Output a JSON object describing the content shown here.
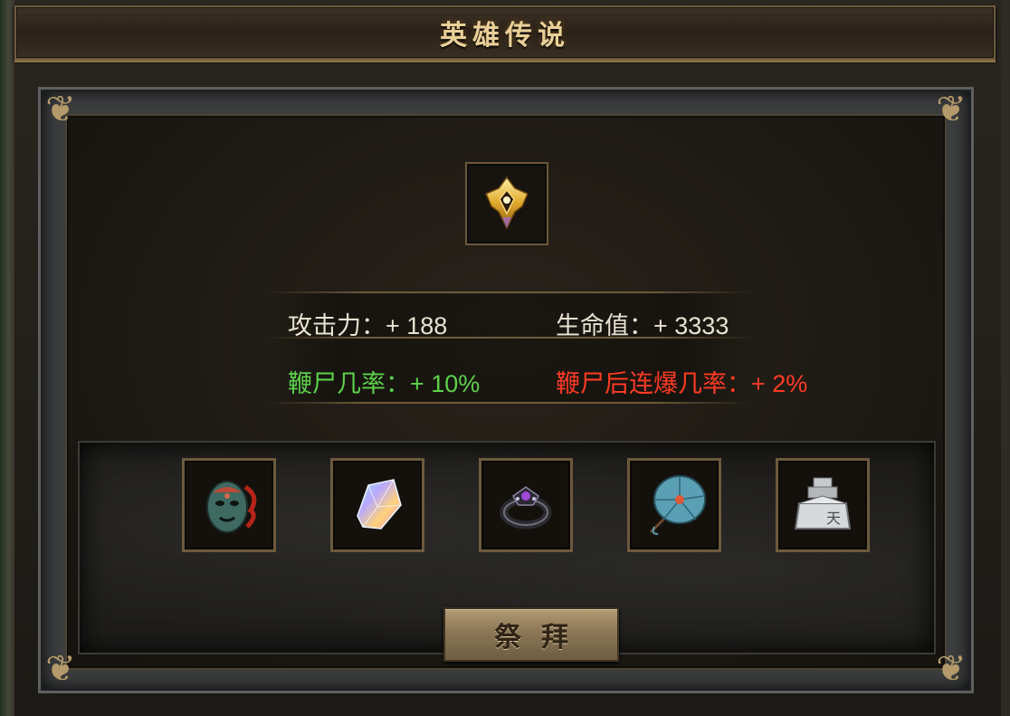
{
  "window": {
    "title": "英雄传说"
  },
  "emblem": {
    "icon": "gold-crest-emblem-icon"
  },
  "stats": {
    "attack": "攻击力：+ 188",
    "hp": "生命值：+ 3333",
    "whip_rate": "鞭尸几率：+ 10%",
    "whip_combo_rate": "鞭尸后连爆几率：+ 2%"
  },
  "colors": {
    "title_gold": "#e9cf98",
    "stat_white": "#e8e2d2",
    "stat_green": "#5cd14a",
    "stat_red": "#ff3b23",
    "frame_gold": "#6d5a3d"
  },
  "items": [
    {
      "name": "jade-mask",
      "icon": "mask-icon"
    },
    {
      "name": "rainbow-crystal",
      "icon": "crystal-icon"
    },
    {
      "name": "dark-ring",
      "icon": "ring-icon"
    },
    {
      "name": "oil-paper-umbrella",
      "icon": "umbrella-icon"
    },
    {
      "name": "stone-seal",
      "icon": "seal-icon"
    }
  ],
  "action": {
    "pray_label": "祭拜"
  }
}
